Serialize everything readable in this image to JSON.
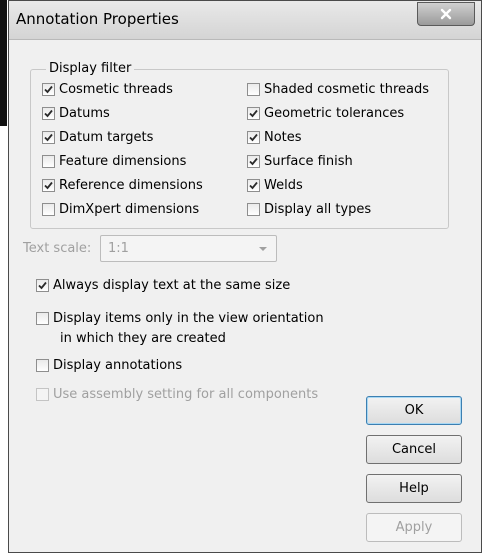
{
  "dialog": {
    "title": "Annotation Properties",
    "close_icon": "close-x-icon"
  },
  "display_filter": {
    "legend": "Display filter",
    "left": [
      {
        "label": "Cosmetic threads",
        "checked": true
      },
      {
        "label": "Datums",
        "checked": true
      },
      {
        "label": "Datum targets",
        "checked": true
      },
      {
        "label": "Feature dimensions",
        "checked": false
      },
      {
        "label": "Reference dimensions",
        "checked": true
      },
      {
        "label": "DimXpert dimensions",
        "checked": false
      }
    ],
    "right": [
      {
        "label": "Shaded cosmetic threads",
        "checked": false
      },
      {
        "label": "Geometric tolerances",
        "checked": true
      },
      {
        "label": "Notes",
        "checked": true
      },
      {
        "label": "Surface finish",
        "checked": true
      },
      {
        "label": "Welds",
        "checked": true
      },
      {
        "label": "Display all types",
        "checked": false
      }
    ]
  },
  "text_scale": {
    "label": "Text scale:",
    "value": "1:1",
    "enabled": false
  },
  "options": {
    "always_same_size": {
      "label": "Always display text at the same size",
      "checked": true
    },
    "view_orientation_line1": "Display items only in the view orientation",
    "view_orientation_line2": "in which they are created",
    "view_orientation_checked": false,
    "display_annotations": {
      "label": "Display annotations",
      "checked": false
    },
    "use_assembly": {
      "label": "Use assembly setting for all components",
      "checked": false,
      "enabled": false
    }
  },
  "buttons": {
    "ok": "OK",
    "cancel": "Cancel",
    "help": "Help",
    "apply": "Apply"
  },
  "colors": {
    "client_bg": "#f0f0f0",
    "disabled_text": "#a0a0a0",
    "check_mark": "#2a2a2a"
  }
}
